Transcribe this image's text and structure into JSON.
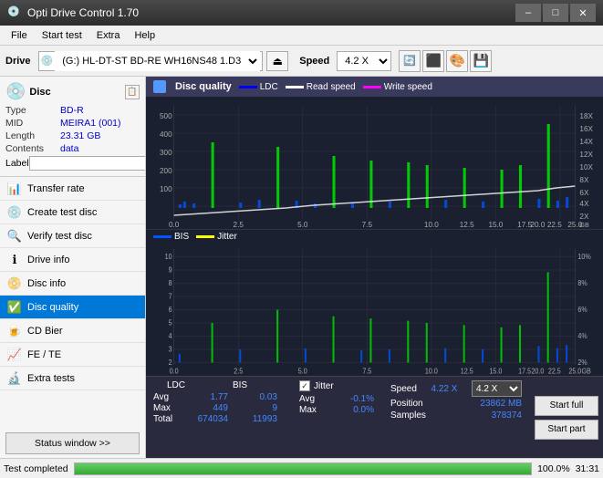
{
  "titleBar": {
    "title": "Opti Drive Control 1.70",
    "icon": "💿",
    "minimize": "–",
    "maximize": "□",
    "close": "✕"
  },
  "menuBar": {
    "items": [
      "File",
      "Start test",
      "Extra",
      "Help"
    ]
  },
  "toolbar": {
    "driveLabel": "Drive",
    "driveValue": "(G:) HL-DT-ST BD-RE  WH16NS48 1.D3",
    "speedLabel": "Speed",
    "speedValue": "4.2 X"
  },
  "disc": {
    "type": "BD-R",
    "mid": "MEIRA1 (001)",
    "length": "23.31 GB",
    "contents": "data",
    "labelPlaceholder": ""
  },
  "nav": {
    "items": [
      {
        "id": "transfer-rate",
        "label": "Transfer rate",
        "icon": "📊"
      },
      {
        "id": "create-test",
        "label": "Create test disc",
        "icon": "💿"
      },
      {
        "id": "verify-test",
        "label": "Verify test disc",
        "icon": "🔍"
      },
      {
        "id": "drive-info",
        "label": "Drive info",
        "icon": "ℹ"
      },
      {
        "id": "disc-info",
        "label": "Disc info",
        "icon": "📀"
      },
      {
        "id": "disc-quality",
        "label": "Disc quality",
        "icon": "✅",
        "active": true
      },
      {
        "id": "cd-bier",
        "label": "CD Bier",
        "icon": "🍺"
      },
      {
        "id": "fe-te",
        "label": "FE / TE",
        "icon": "📈"
      },
      {
        "id": "extra-tests",
        "label": "Extra tests",
        "icon": "🔬"
      }
    ],
    "statusBtn": "Status window >>"
  },
  "chart": {
    "title": "Disc quality",
    "legend": [
      {
        "label": "LDC",
        "color": "#0000ff"
      },
      {
        "label": "Read speed",
        "color": "#ffffff"
      },
      {
        "label": "Write speed",
        "color": "#ff00ff"
      }
    ],
    "legend2": [
      {
        "label": "BIS",
        "color": "#0000ff"
      },
      {
        "label": "Jitter",
        "color": "#ffff00"
      }
    ],
    "xMax": "25.0",
    "yMaxTop": 500,
    "yMaxBottom": 10
  },
  "stats": {
    "columns": [
      "LDC",
      "BIS"
    ],
    "rows": [
      {
        "label": "Avg",
        "ldc": "1.77",
        "bis": "0.03",
        "jitter": "-0.1%"
      },
      {
        "label": "Max",
        "ldc": "449",
        "bis": "9",
        "jitter": "0.0%"
      },
      {
        "label": "Total",
        "ldc": "674034",
        "bis": "11993",
        "jitter": ""
      }
    ],
    "jitterLabel": "Jitter",
    "speedLabel": "Speed",
    "speedVal": "4.22 X",
    "speedSelect": "4.2 X",
    "positionLabel": "Position",
    "positionVal": "23862 MB",
    "samplesLabel": "Samples",
    "samplesVal": "378374",
    "startFull": "Start full",
    "startPart": "Start part"
  },
  "statusBar": {
    "message": "Test completed",
    "progress": 100,
    "progressText": "100.0%",
    "time": "31:31"
  }
}
